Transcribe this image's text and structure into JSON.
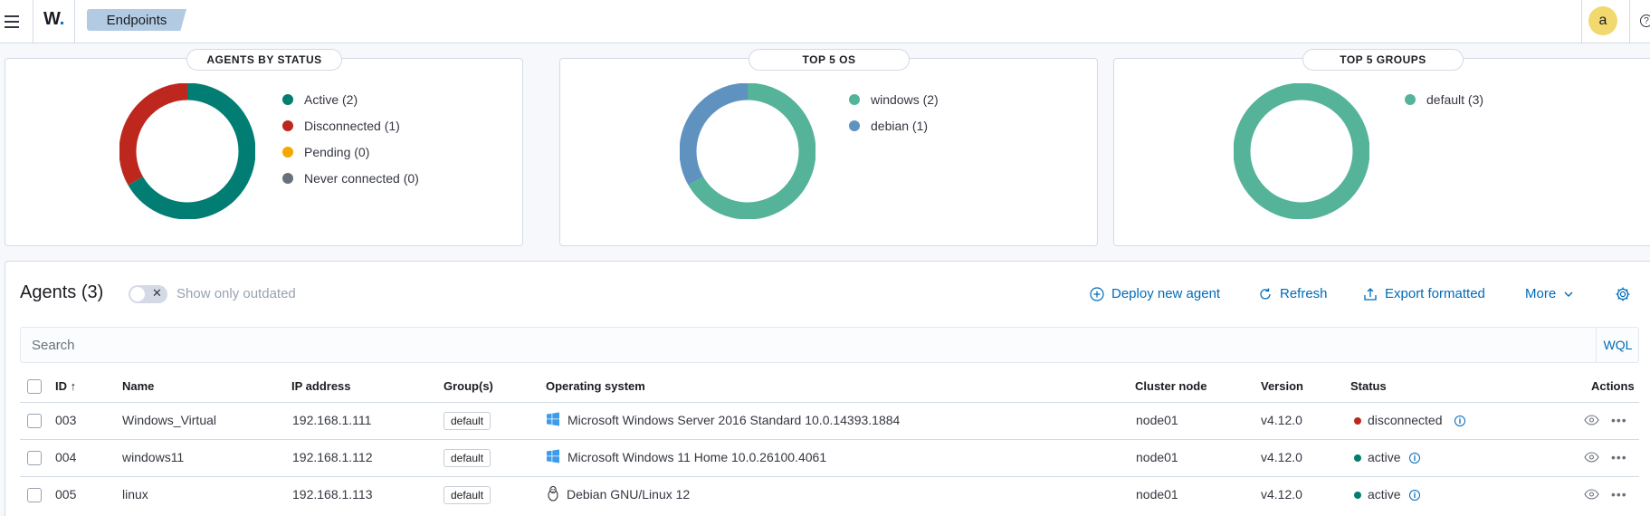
{
  "header": {
    "logo_text": "W",
    "logo_dot": ".",
    "breadcrumb": "Endpoints",
    "avatar_letter": "a",
    "help_glyph": "?"
  },
  "panels": {
    "status": {
      "title": "AGENTS BY STATUS",
      "legend": [
        {
          "label": "Active (2)",
          "value": 2,
          "color": "#017d73"
        },
        {
          "label": "Disconnected (1)",
          "value": 1,
          "color": "#bd271e"
        },
        {
          "label": "Pending (0)",
          "value": 0,
          "color": "#f5a700"
        },
        {
          "label": "Never connected (0)",
          "value": 0,
          "color": "#69707d"
        }
      ]
    },
    "os": {
      "title": "TOP 5 OS",
      "legend": [
        {
          "label": "windows (2)",
          "value": 2,
          "color": "#54b399"
        },
        {
          "label": "debian (1)",
          "value": 1,
          "color": "#6092c0"
        }
      ]
    },
    "groups": {
      "title": "TOP 5 GROUPS",
      "legend": [
        {
          "label": "default (3)",
          "value": 3,
          "color": "#54b399"
        }
      ]
    }
  },
  "agents": {
    "title": "Agents (3)",
    "toggle_label": "Show only outdated",
    "toggle_glyph": "✕",
    "buttons": {
      "deploy": "Deploy new agent",
      "refresh": "Refresh",
      "export": "Export formatted",
      "more": "More"
    },
    "search_placeholder": "Search",
    "wql": "WQL",
    "columns": {
      "id": "ID",
      "sort_glyph": "↑",
      "name": "Name",
      "ip": "IP address",
      "groups": "Group(s)",
      "os": "Operating system",
      "cluster": "Cluster node",
      "version": "Version",
      "status": "Status",
      "actions": "Actions"
    },
    "rows": [
      {
        "id": "003",
        "name": "Windows_Virtual",
        "ip": "192.168.1.111",
        "group": "default",
        "os_icon": "windows-icon",
        "os": "Microsoft Windows Server 2016 Standard 10.0.14393.1884",
        "cluster": "node01",
        "version": "v4.12.0",
        "status": "disconnected",
        "status_color": "#bd271e"
      },
      {
        "id": "004",
        "name": "windows11",
        "ip": "192.168.1.112",
        "group": "default",
        "os_icon": "windows-icon",
        "os": "Microsoft Windows 11 Home 10.0.26100.4061",
        "cluster": "node01",
        "version": "v4.12.0",
        "status": "active",
        "status_color": "#017d73"
      },
      {
        "id": "005",
        "name": "linux",
        "ip": "192.168.1.113",
        "group": "default",
        "os_icon": "linux-icon",
        "os": "Debian GNU/Linux 12",
        "cluster": "node01",
        "version": "v4.12.0",
        "status": "active",
        "status_color": "#017d73"
      }
    ],
    "info_glyph": "i",
    "more_glyph": "•••"
  }
}
